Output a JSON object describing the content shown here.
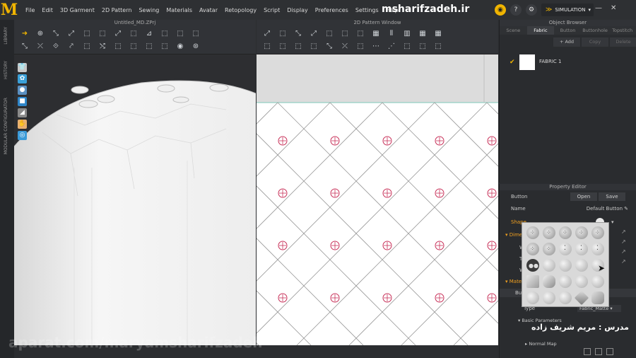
{
  "app": {
    "logo": "M"
  },
  "menu": [
    "File",
    "Edit",
    "3D Garment",
    "2D Pattern",
    "Sewing",
    "Materials",
    "Avatar",
    "Retopology",
    "Script",
    "Display",
    "Preferences",
    "Settings",
    "Help"
  ],
  "watermark_site": "msharifzadeh.ir",
  "top_right": {
    "help_icon": "?",
    "simulation_label": "SIMULATION"
  },
  "left_strip": {
    "labels": [
      "LIBRARY",
      "HISTORY",
      "MODULAR CONFIGURATOR"
    ]
  },
  "window3d": {
    "title": "Untitled_MD.ZPrj"
  },
  "window2d": {
    "title": "2D Pattern Window"
  },
  "object_browser": {
    "title": "Object Browser",
    "tabs": [
      "Scene",
      "Fabric",
      "Button",
      "Buttonhole",
      "Topstitch"
    ],
    "active_tab": "Fabric",
    "actions": [
      "+ Add",
      "Copy",
      "Delete"
    ],
    "fabric_item": "FABRIC 1"
  },
  "property_editor": {
    "title": "Property Editor",
    "object_type": "Button",
    "open_label": "Open",
    "save_label": "Save",
    "name_label": "Name",
    "name_value": "Default Button",
    "shape_label": "Shape",
    "dimension_label": "Dimen",
    "width_label": "Wi",
    "thickness_label": "Th",
    "weight_label": "Wi",
    "material_label": "Materi",
    "button_label": "Butt",
    "type_label": "Type",
    "type_value": "Fabric_Matte",
    "basic_params_label": "Basic Parameters",
    "normal_map_label": "Normal Map"
  },
  "teacher_caption": "مدرس : مریم شریف زاده",
  "aparat_watermark": "aparat.com/maryamsharifzadeh",
  "colors": {
    "accent": "#f0b400",
    "orange_label": "#f0a020",
    "pattern_mark": "#c8325a",
    "grid_line": "#9a9a9a"
  }
}
